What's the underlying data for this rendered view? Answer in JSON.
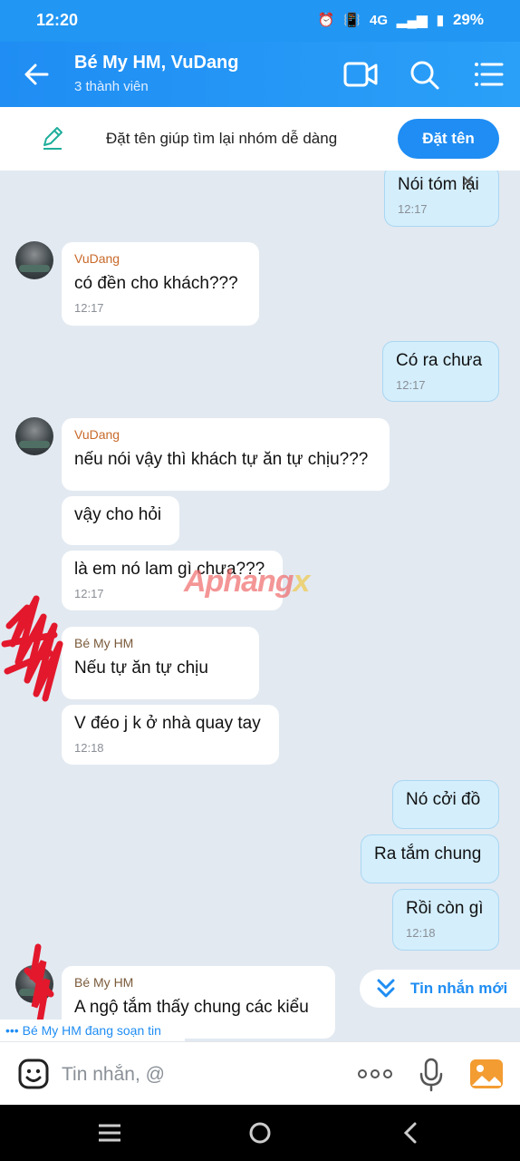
{
  "status": {
    "time": "12:20",
    "battery": "29%",
    "network": "4G"
  },
  "header": {
    "title": "Bé My HM, VuDang",
    "subtitle": "3 thành viên"
  },
  "name_prompt": {
    "hint": "Đặt tên giúp tìm lại nhóm dễ dàng",
    "button": "Đặt tên"
  },
  "messages": [
    {
      "dir": "out",
      "text": "Nói tóm lại",
      "time": "12:17"
    },
    {
      "dir": "in",
      "sender": "VuDang",
      "text": "có đền cho khách???",
      "time": "12:17"
    },
    {
      "dir": "out",
      "text": "Có ra chưa",
      "time": "12:17"
    },
    {
      "dir": "in",
      "sender": "VuDang",
      "text": "nếu nói vậy thì khách tự ăn tự chịu???"
    },
    {
      "dir": "in",
      "text": "vậy cho hỏi"
    },
    {
      "dir": "in",
      "text": "là em nó lam gì chưa???",
      "time": "12:17"
    },
    {
      "dir": "in",
      "sender": "Bé My HM",
      "text": "Nếu tự ăn tự chịu"
    },
    {
      "dir": "in",
      "text": "V đéo j k ở nhà quay tay",
      "time": "12:18"
    },
    {
      "dir": "out",
      "text": "Nó cởi đồ"
    },
    {
      "dir": "out",
      "text": "Ra tắm chung"
    },
    {
      "dir": "out",
      "text": "Rồi còn gì",
      "time": "12:18"
    },
    {
      "dir": "in",
      "sender": "Bé My HM",
      "text": "A ngộ tắm thấy chung các kiểu"
    }
  ],
  "typing_indicator": "Bé My HM đang soạn tin",
  "new_messages_button": "Tin nhắn mới",
  "composer": {
    "placeholder": "Tin nhắn, @"
  },
  "watermark": {
    "main": "Aphang",
    "accent": "x"
  },
  "icons": [
    "back-arrow-icon",
    "video-call-icon",
    "search-icon",
    "menu-icon",
    "pen-icon",
    "sticker-icon",
    "more-icon",
    "mic-icon",
    "gallery-icon"
  ],
  "colors": {
    "accent": "#1f8df3",
    "outgoing_bubble": "#d4eefc",
    "background": "#e2e9f1"
  }
}
